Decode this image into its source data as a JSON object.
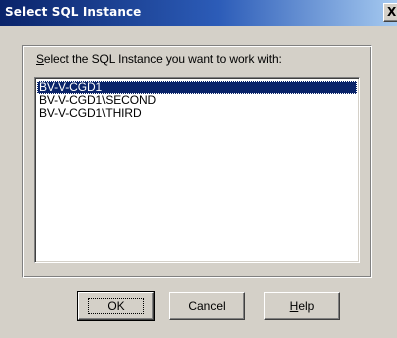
{
  "window": {
    "title": "Select SQL Instance",
    "close_glyph": "X"
  },
  "group": {
    "prompt_mnemonic": "S",
    "prompt_rest": "elect the SQL Instance you want to work with:"
  },
  "instances": [
    {
      "label": "BV-V-CGD1",
      "selected": true
    },
    {
      "label": "BV-V-CGD1\\SECOND",
      "selected": false
    },
    {
      "label": "BV-V-CGD1\\THIRD",
      "selected": false
    }
  ],
  "buttons": {
    "ok_label": "OK",
    "cancel_label": "Cancel",
    "help_mnemonic": "H",
    "help_rest": "elp"
  },
  "colors": {
    "title_bar_start": "#0a246a",
    "title_bar_end": "#a6caf0",
    "dialog_face": "#d4d0c8",
    "selection": "#0a246a"
  }
}
